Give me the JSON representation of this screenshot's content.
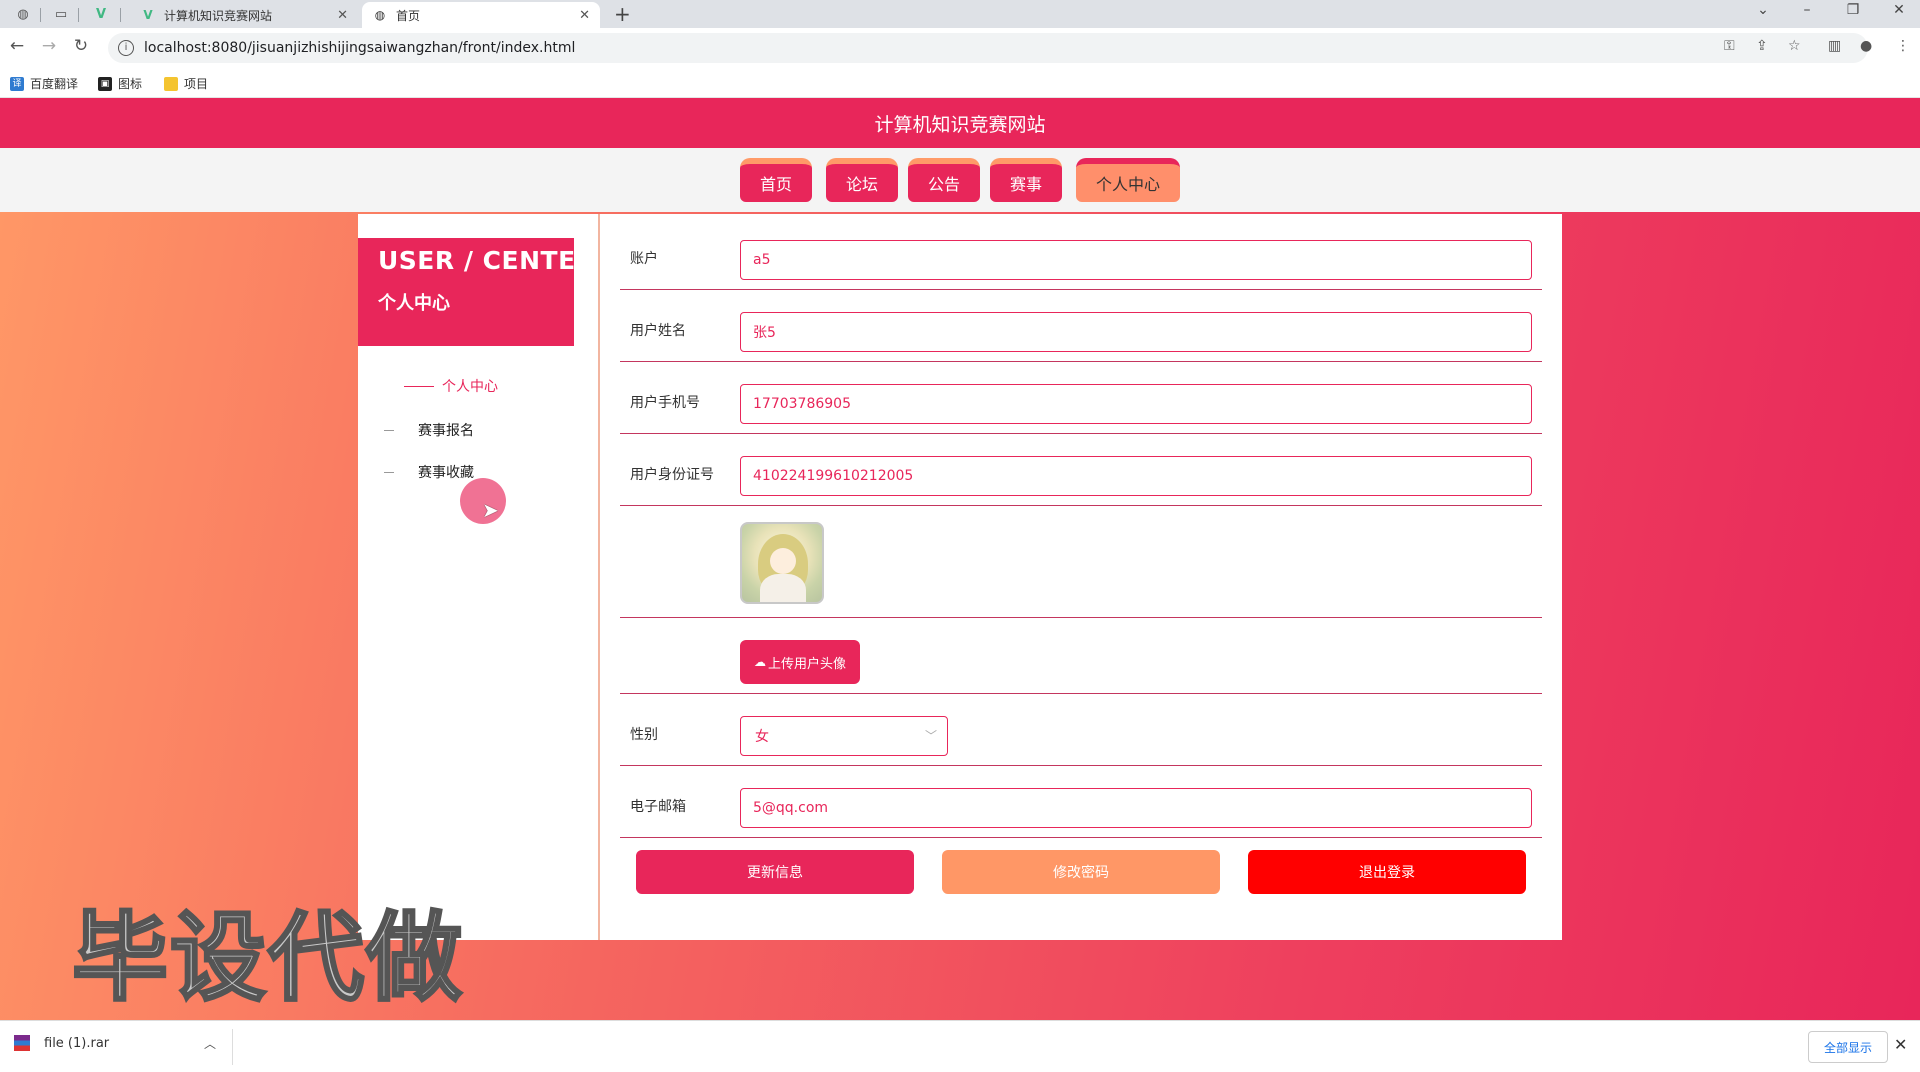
{
  "browser": {
    "tabs": [
      {
        "title": "计算机知识竞赛网站",
        "favicon": "vue-logo-icon",
        "active": false
      },
      {
        "title": "首页",
        "favicon": "globe-icon",
        "active": true
      }
    ],
    "address": "localhost:8080/jisuanjizhishijingsaiwangzhan/front/index.html",
    "bookmarks": [
      {
        "label": "百度翻译",
        "color": "#2f7bd0",
        "glyph": "译"
      },
      {
        "label": "图标",
        "color": "#222222",
        "glyph": "▣"
      },
      {
        "label": "项目",
        "color": "#f4c430",
        "glyph": ""
      }
    ]
  },
  "site": {
    "title": "计算机知识竞赛网站",
    "nav": [
      "首页",
      "论坛",
      "公告",
      "赛事",
      "个人中心"
    ],
    "active_nav": "个人中心",
    "colors": {
      "primary": "#e8265a",
      "accent": "#ff8f6b",
      "danger": "#ff0000"
    }
  },
  "sidebar": {
    "banner_en": "USER / CENTER",
    "banner_cn": "个人中心",
    "items": [
      "个人中心",
      "赛事报名",
      "赛事收藏"
    ],
    "active": "个人中心"
  },
  "form": {
    "account": {
      "label": "账户",
      "value": "a5"
    },
    "name": {
      "label": "用户姓名",
      "value": "张5"
    },
    "phone": {
      "label": "用户手机号",
      "value": "17703786905"
    },
    "idcard": {
      "label": "用户身份证号",
      "value": "410224199610212005"
    },
    "upload_label": "上传用户头像",
    "gender": {
      "label": "性别",
      "value": "女"
    },
    "email": {
      "label": "电子邮箱",
      "value": "5@qq.com"
    },
    "buttons": {
      "update": "更新信息",
      "password": "修改密码",
      "logout": "退出登录"
    }
  },
  "watermark": "毕设代做",
  "downloads": {
    "file": "file (1).rar",
    "show_all": "全部显示"
  }
}
